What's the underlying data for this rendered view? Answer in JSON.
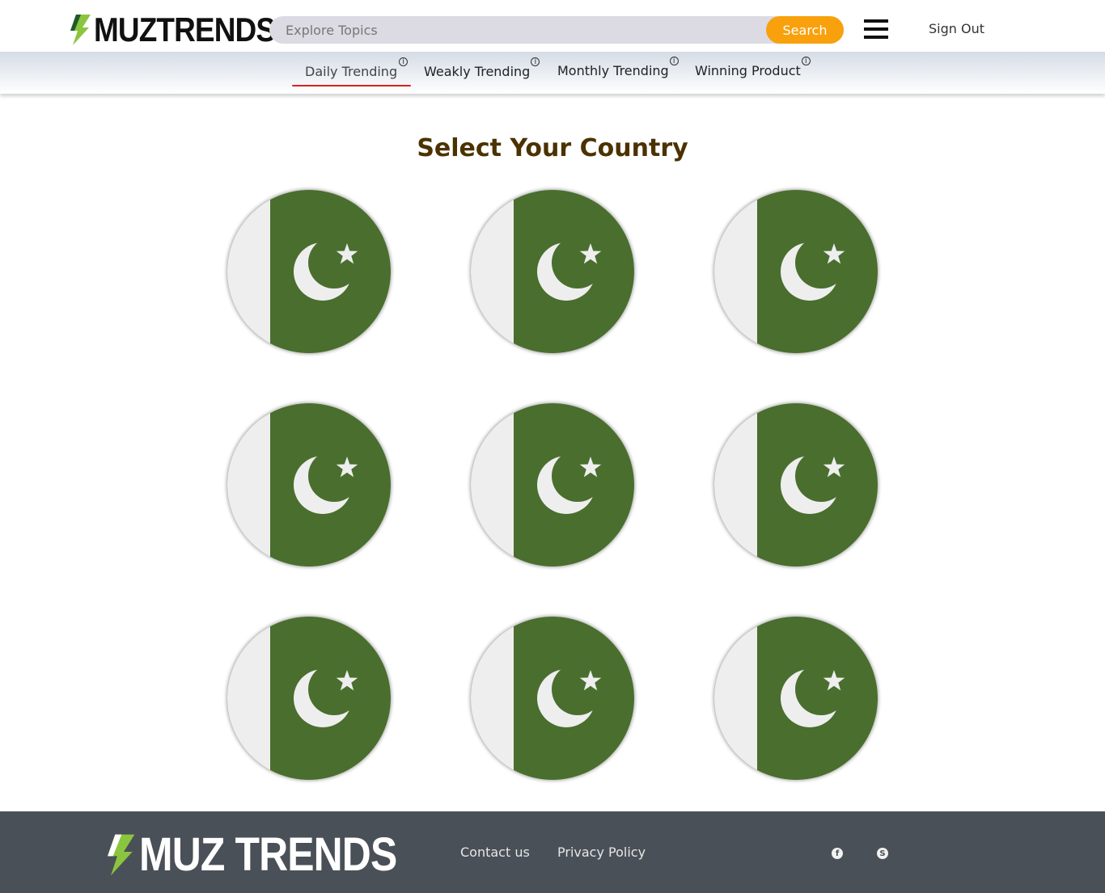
{
  "header": {
    "logo_text": "MUZTRENDS",
    "search": {
      "placeholder": "Explore Topics",
      "button_label": "Search"
    },
    "sign_out_label": "Sign Out"
  },
  "tabs": [
    {
      "label": "Daily Trending",
      "info": "i",
      "active": true
    },
    {
      "label": "Weakly Trending",
      "info": "i",
      "active": false
    },
    {
      "label": "Monthly Trending",
      "info": "i",
      "active": false
    },
    {
      "label": "Winning Product",
      "info": "i",
      "active": false
    }
  ],
  "main": {
    "title": "Select Your Country",
    "flags": [
      "pakistan-flag",
      "pakistan-flag",
      "pakistan-flag",
      "pakistan-flag",
      "pakistan-flag",
      "pakistan-flag",
      "pakistan-flag",
      "pakistan-flag",
      "pakistan-flag"
    ]
  },
  "footer": {
    "logo_text": "MUZ TRENDS",
    "links": [
      "Contact us",
      "Privacy Policy"
    ],
    "social": [
      "facebook-icon",
      "skype-icon"
    ]
  },
  "colors": {
    "accent": "#f8a10c",
    "tab_underline": "#d9221c",
    "title": "#4b3200",
    "flag_green": "#4a6e2e",
    "flag_white": "#eeeeee",
    "footer_bg": "#4a5057"
  }
}
